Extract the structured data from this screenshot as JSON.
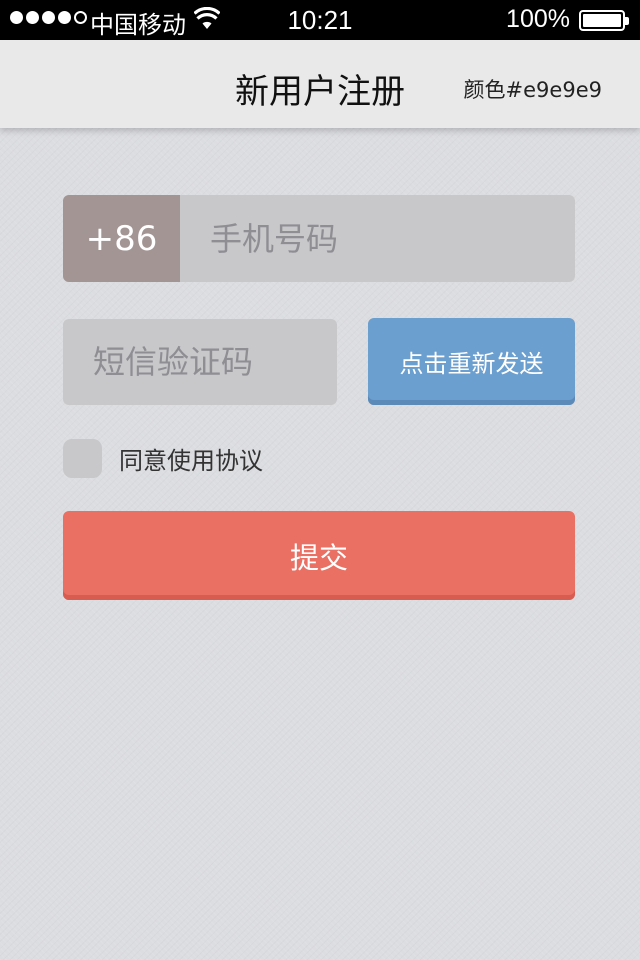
{
  "status_bar": {
    "carrier": "中国移动",
    "time": "10:21",
    "battery": "100%",
    "signal_bars_filled": 4,
    "signal_bars_total": 5,
    "battery_level": 1.0
  },
  "nav": {
    "title": "新用户注册",
    "note": "颜色#e9e9e9"
  },
  "form": {
    "country_code": "+86",
    "phone_placeholder": "手机号码",
    "sms_placeholder": "短信验证码",
    "resend_label": "点击重新发送",
    "agree_label": "同意使用协议",
    "submit_label": "提交"
  },
  "colors": {
    "nav_bg": "#e9e9e9",
    "country_code_bg": "#a39594",
    "resend_button": "#6b9fd0",
    "submit_button": "#e97063",
    "input_bg": "#c8c8cb"
  }
}
